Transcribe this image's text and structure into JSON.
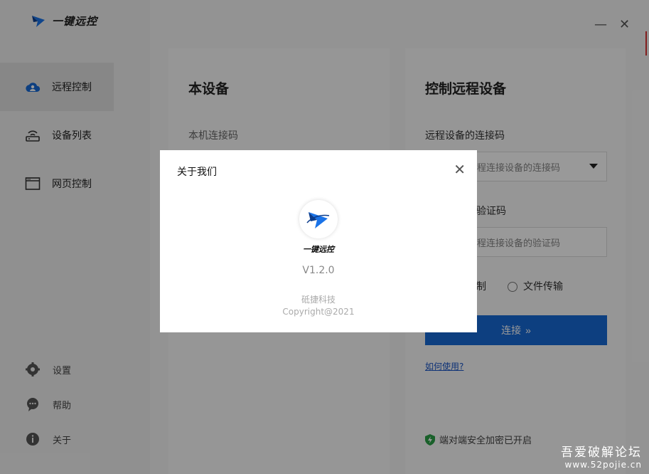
{
  "app": {
    "name": "一键远控"
  },
  "sidebar": {
    "items": [
      {
        "label": "远程控制",
        "icon": "cloud-user-icon",
        "active": true
      },
      {
        "label": "设备列表",
        "icon": "router-icon",
        "active": false
      },
      {
        "label": "网页控制",
        "icon": "browser-window-icon",
        "active": false
      }
    ],
    "bottom": [
      {
        "label": "设置",
        "icon": "gear-icon"
      },
      {
        "label": "帮助",
        "icon": "chat-help-icon"
      },
      {
        "label": "关于",
        "icon": "info-icon"
      }
    ]
  },
  "local": {
    "title": "本设备",
    "code_label": "本机连接码"
  },
  "remote": {
    "title": "控制远程设备",
    "code_label": "远程设备的连接码",
    "code_placeholder": "程连接设备的连接码",
    "verify_label": "验证码",
    "verify_placeholder": "程连接设备的验证码",
    "options": [
      "制",
      "文件传输"
    ],
    "connect_label": "连接",
    "help_link": "如何使用?",
    "security_text": "端对端安全加密已开启"
  },
  "dialog": {
    "title": "关于我们",
    "app_name": "一键远控",
    "version": "V1.2.0",
    "company": "砥捷科技",
    "copyright": "Copyright@2021"
  },
  "watermark": {
    "line1": "吾爱破解论坛",
    "line2": "www.52pojie.cn"
  },
  "colors": {
    "accent": "#1769d6",
    "logo_blue": "#1a73e8",
    "shield_green": "#2aa146"
  }
}
